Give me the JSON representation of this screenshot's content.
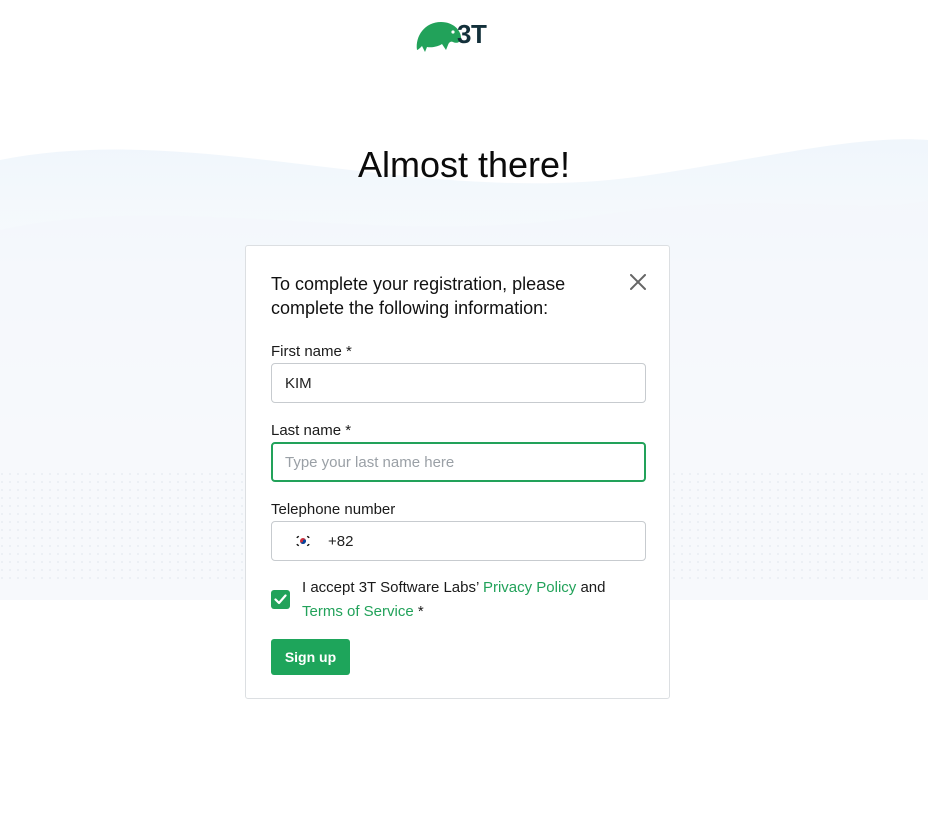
{
  "brand": {
    "logo_text": "3T",
    "accent_color": "#22a25a"
  },
  "page": {
    "title": "Almost there!"
  },
  "dialog": {
    "heading": "To complete your registration, please complete the following information:",
    "close_icon": "close-icon",
    "first_name": {
      "label": "First name *",
      "value": "KIM"
    },
    "last_name": {
      "label": "Last name *",
      "value": "",
      "placeholder": "Type your last name here"
    },
    "telephone": {
      "label": "Telephone number",
      "flag_icon": "south-korea-flag-icon",
      "dial_code": "+82"
    },
    "consent": {
      "checked": true,
      "text_before": "I accept 3T Software Labs’ ",
      "privacy_link": "Privacy Policy",
      "text_middle": " and ",
      "terms_link": "Terms of Service",
      "text_after": " *"
    },
    "submit_label": "Sign up"
  }
}
